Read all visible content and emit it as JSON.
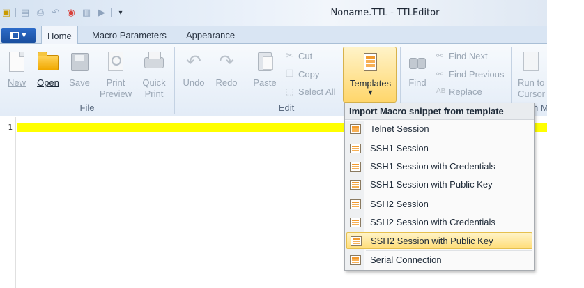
{
  "window": {
    "title": "Noname.TTL - TTLEditor"
  },
  "tabs": [
    {
      "label": "Home",
      "active": true
    },
    {
      "label": "Macro Parameters",
      "active": false
    },
    {
      "label": "Appearance",
      "active": false
    }
  ],
  "ribbon": {
    "file_group": {
      "label": "File",
      "new": "New",
      "open": "Open",
      "save": "Save",
      "print_preview": "Print Preview",
      "quick_print": "Quick Print"
    },
    "edit_group": {
      "label": "Edit",
      "undo": "Undo",
      "redo": "Redo",
      "paste": "Paste",
      "cut": "Cut",
      "copy": "Copy",
      "select_all": "Select All"
    },
    "templates": {
      "label": "Templates"
    },
    "find_group": {
      "find": "Find",
      "find_next": "Find Next",
      "find_previous": "Find Previous",
      "replace": "Replace"
    },
    "run_group": {
      "run_to_cursor": "Run to Cursor",
      "label_partial": "n M"
    }
  },
  "editor": {
    "line_number": "1"
  },
  "dropdown": {
    "header": "Import Macro snippet from template",
    "items": [
      {
        "label": "Telnet Session",
        "highlighted": false
      },
      {
        "label": "SSH1 Session",
        "highlighted": false
      },
      {
        "label": "SSH1 Session with Credentials",
        "highlighted": false
      },
      {
        "label": "SSH1 Session with Public Key",
        "highlighted": false
      },
      {
        "label": "SSH2 Session",
        "highlighted": false
      },
      {
        "label": "SSH2 Session with Credentials",
        "highlighted": false
      },
      {
        "label": "SSH2 Session with Public Key",
        "highlighted": true
      },
      {
        "label": "Serial Connection",
        "highlighted": false
      }
    ]
  },
  "colors": {
    "current_line": "#ffff00",
    "highlight": "#ffde7a",
    "accent": "#1a4f9f"
  }
}
